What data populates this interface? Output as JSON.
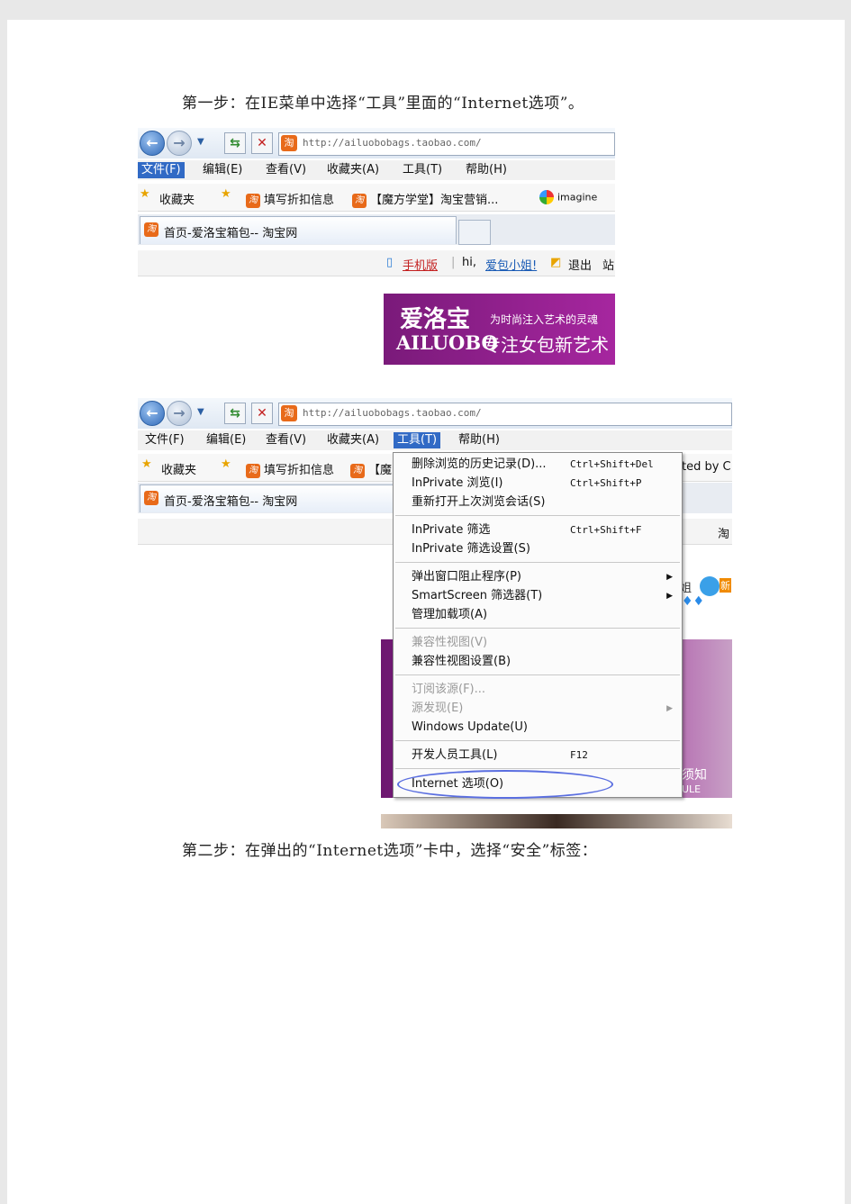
{
  "doc": {
    "step1": "第一步：在IE菜单中选择“工具”里面的“Internet选项”。",
    "step2": "第二步：在弹出的“Internet选项”卡中，选择“安全”标签："
  },
  "shot1": {
    "address": "http://ailuobobags.taobao.com/",
    "menu": [
      "文件(F)",
      "编辑(E)",
      "查看(V)",
      "收藏夹(A)",
      "工具(T)",
      "帮助(H)"
    ],
    "favorites": {
      "label": "收藏夹",
      "item1": "填写折扣信息",
      "item2": "【魔方学堂】淘宝营销...",
      "item3": "imagine"
    },
    "tab": "首页-爱洛宝箱包-- 淘宝网",
    "cmd": {
      "mobile": "手机版",
      "greeting": "hi,",
      "user": "爱包小姐!",
      "logout": "退出",
      "site": "站"
    },
    "banner": {
      "brand_cn": "爱洛宝",
      "slogan1": "为时尚注入艺术的灵魂",
      "brand_en": "AILUOBO",
      "slogan2": "专注女包新艺术"
    }
  },
  "shot2": {
    "address": "http://ailuobobags.taobao.com/",
    "menu": [
      "文件(F)",
      "编辑(E)",
      "查看(V)",
      "收藏夹(A)",
      "工具(T)",
      "帮助(H)"
    ],
    "favorites": {
      "label": "收藏夹",
      "item1": "填写折扣信息",
      "item2": "【魔",
      "extra": "ted by C"
    },
    "tab": "首页-爱洛宝箱包-- 淘宝网",
    "cmd_right": "淘",
    "tools_menu": [
      {
        "label": "删除浏览的历史记录(D)...",
        "shortcut": "Ctrl+Shift+Del"
      },
      {
        "label": "InPrivate 浏览(I)",
        "shortcut": "Ctrl+Shift+P"
      },
      {
        "label": "重新打开上次浏览会话(S)",
        "shortcut": ""
      },
      {
        "label": "InPrivate 筛选",
        "shortcut": "Ctrl+Shift+F"
      },
      {
        "label": "InPrivate 筛选设置(S)",
        "shortcut": ""
      },
      {
        "label": "弹出窗口阻止程序(P)",
        "shortcut": ""
      },
      {
        "label": "SmartScreen 筛选器(T)",
        "shortcut": ""
      },
      {
        "label": "管理加载项(A)",
        "shortcut": ""
      },
      {
        "label": "兼容性视图(V)",
        "shortcut": ""
      },
      {
        "label": "兼容性视图设置(B)",
        "shortcut": ""
      },
      {
        "label": "订阅该源(F)...",
        "shortcut": ""
      },
      {
        "label": "源发现(E)",
        "shortcut": ""
      },
      {
        "label": "Windows Update(U)",
        "shortcut": ""
      },
      {
        "label": "开发人员工具(L)",
        "shortcut": "F12"
      },
      {
        "label": "Internet 选项(O)",
        "shortcut": ""
      }
    ],
    "side_text": {
      "a": "姐",
      "b": "新",
      "notice": "须知",
      "rule": "ULE"
    }
  },
  "colors": {
    "menu_highlight": "#316ac5",
    "banner": "#8e1f8c",
    "annotation": "#5a6ee0"
  }
}
